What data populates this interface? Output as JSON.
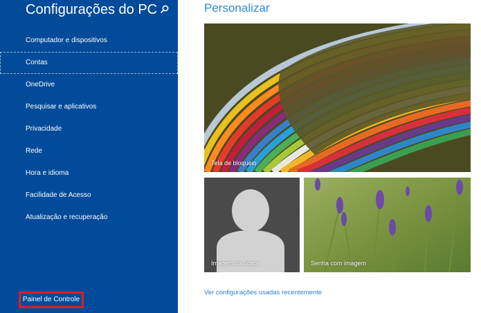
{
  "sidebar": {
    "title": "Configurações do PC",
    "search_icon": "search-icon",
    "items": [
      {
        "label": "Computador e dispositivos"
      },
      {
        "label": "Contas"
      },
      {
        "label": "OneDrive"
      },
      {
        "label": "Pesquisar e aplicativos"
      },
      {
        "label": "Privacidade"
      },
      {
        "label": "Rede"
      },
      {
        "label": "Hora e idioma"
      },
      {
        "label": "Facilidade de Acesso"
      },
      {
        "label": "Atualização e recuperação"
      }
    ],
    "control_panel_label": "Painel de Controle"
  },
  "main": {
    "title": "Personalizar",
    "tiles": {
      "lock_screen": {
        "label": "Tela de bloqueio"
      },
      "account_picture": {
        "label": "Imagem da conta"
      },
      "picture_password": {
        "label": "Senha com imagem"
      }
    },
    "recent_settings_link": "Ver configurações usadas recentemente"
  },
  "colors": {
    "sidebar_bg": "#014b9a",
    "accent": "#2c8ad8",
    "highlight_box": "#e01e25"
  }
}
